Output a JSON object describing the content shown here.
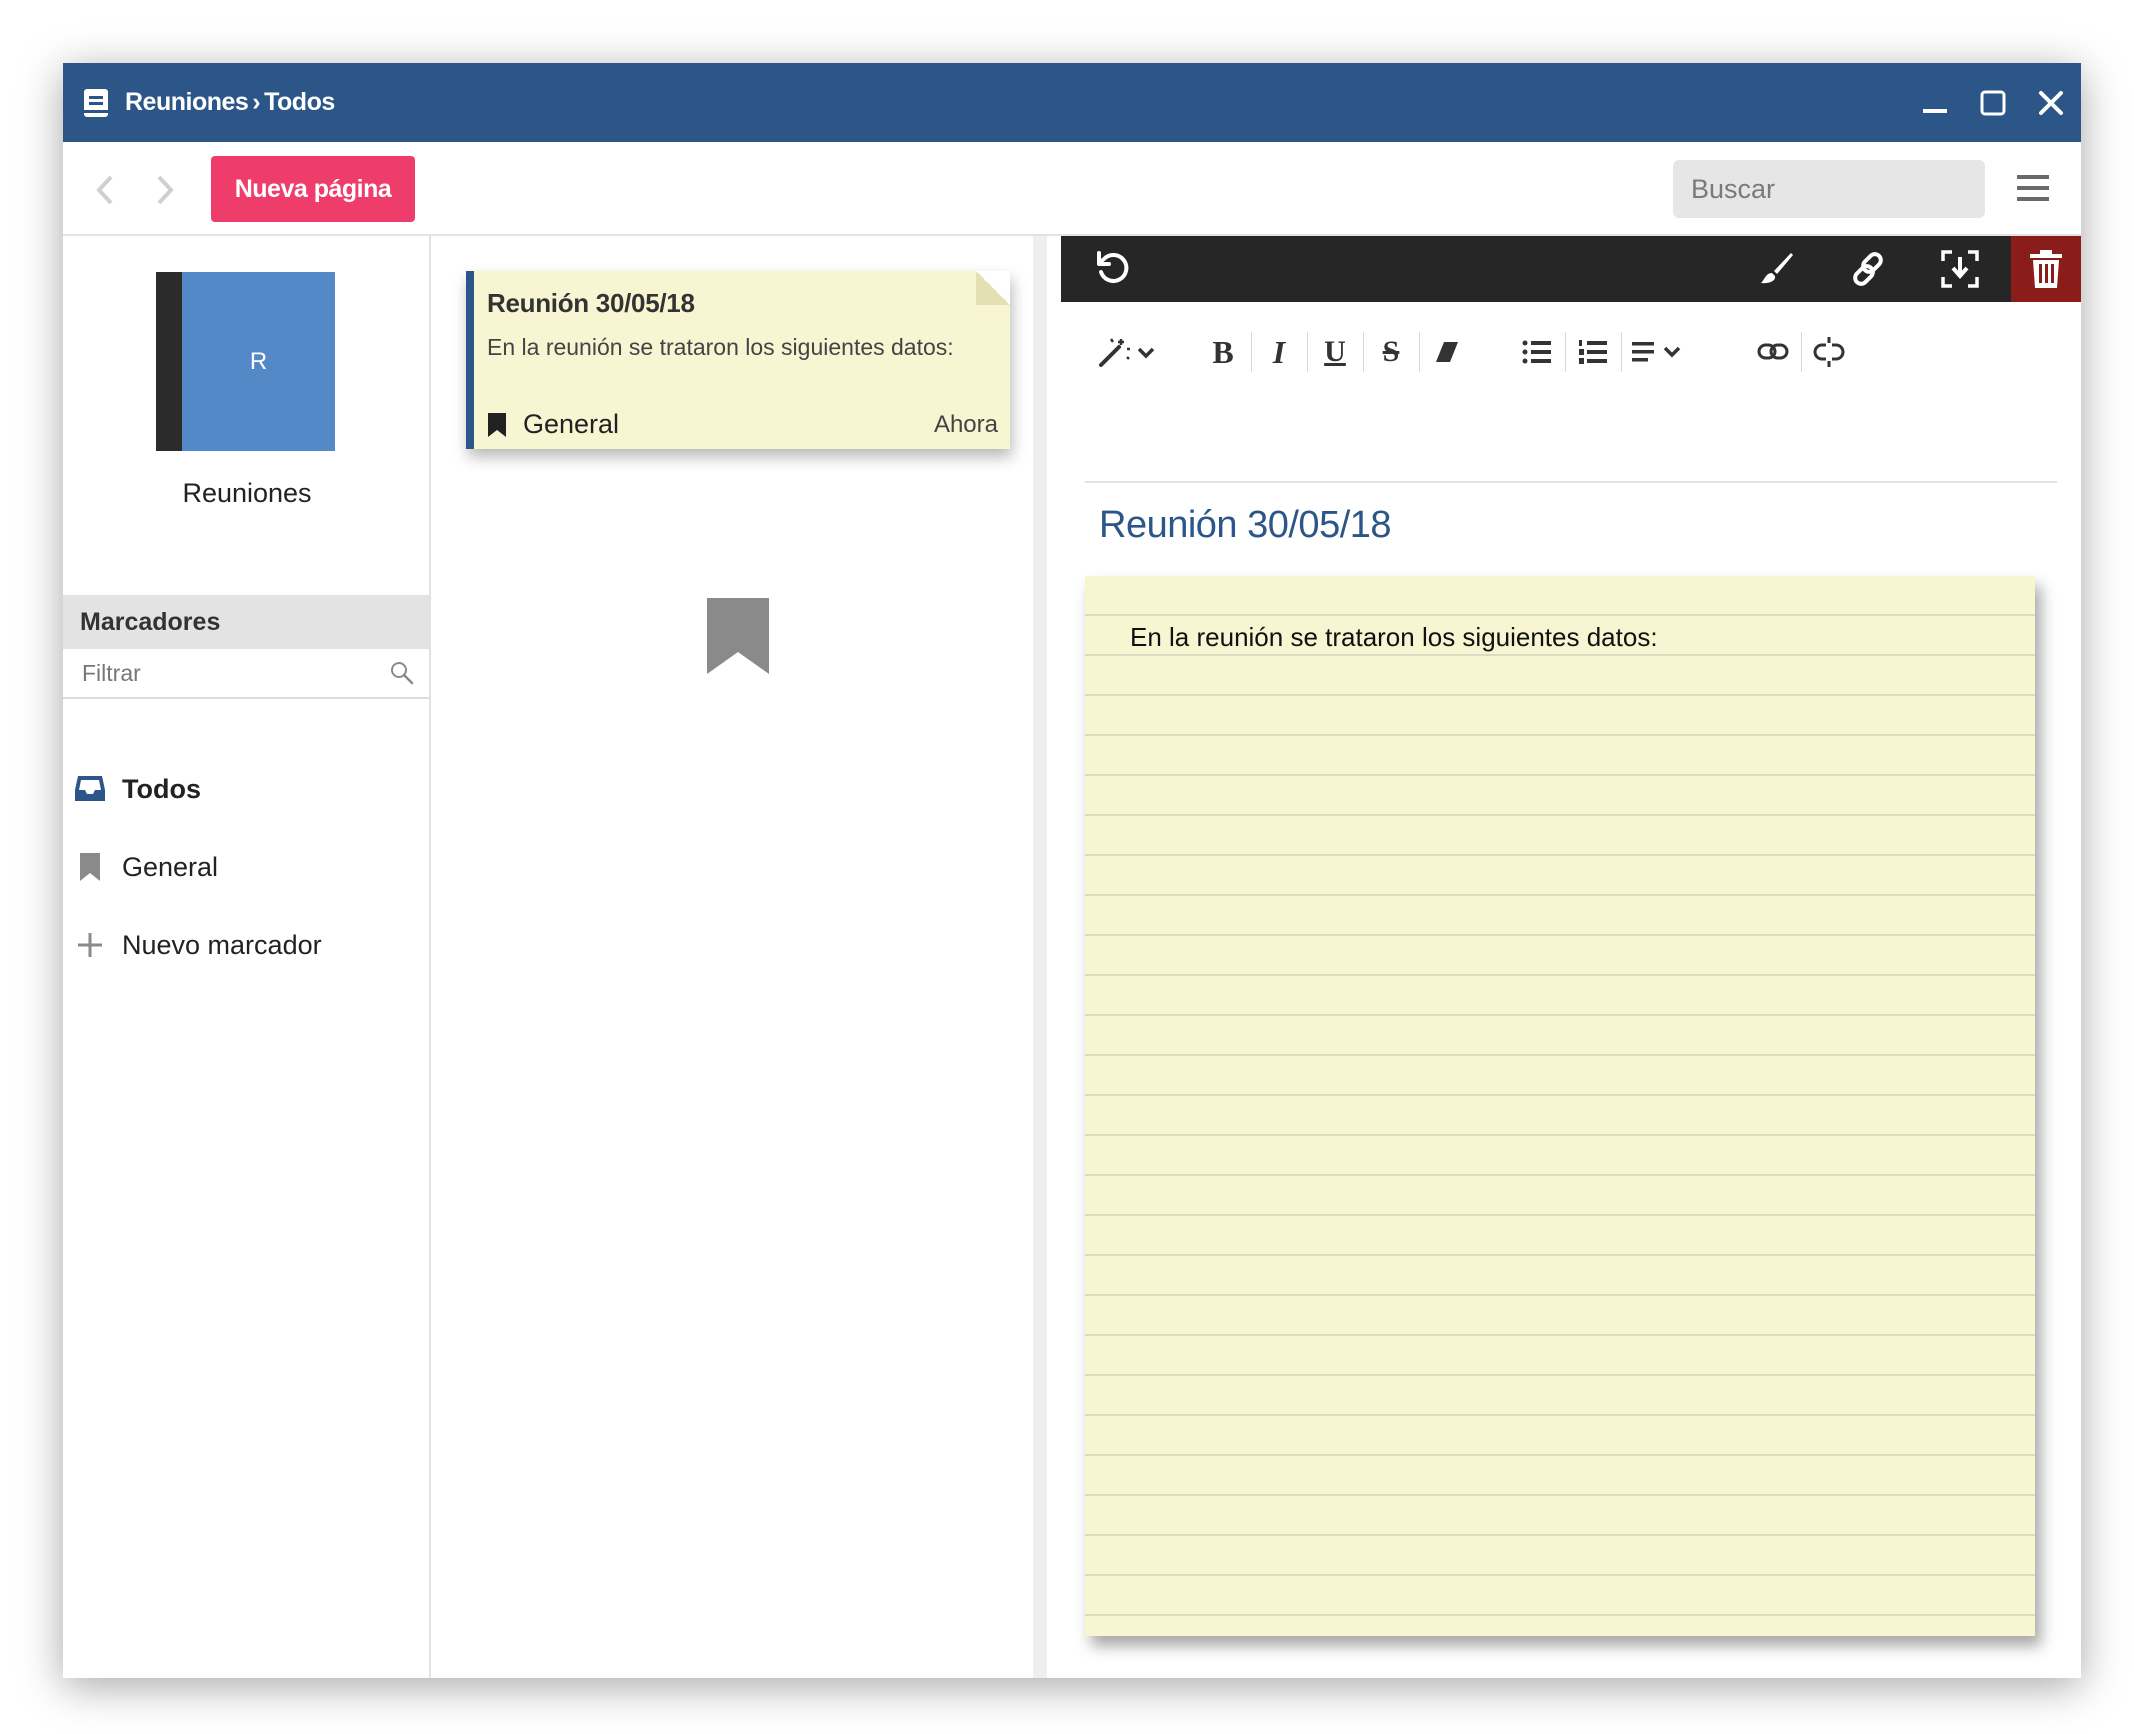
{
  "window": {
    "breadcrumb_root": "Reuniones",
    "breadcrumb_sep": "›",
    "breadcrumb_current": "Todos"
  },
  "toolbar": {
    "new_page_label": "Nueva página",
    "search_placeholder": "Buscar"
  },
  "sidebar": {
    "notebook_initial": "R",
    "notebook_name": "Reuniones",
    "bookmarks_header": "Marcadores",
    "filter_placeholder": "Filtrar",
    "items": [
      {
        "label": "Todos",
        "icon": "inbox-icon"
      },
      {
        "label": "General",
        "icon": "bookmark-icon"
      },
      {
        "label": "Nuevo marcador",
        "icon": "plus-icon"
      }
    ]
  },
  "note_list": {
    "notes": [
      {
        "title": "Reunión 30/05/18",
        "snippet": "En la reunión se trataron los siguientes datos:",
        "bookmark": "General",
        "time": "Ahora"
      }
    ]
  },
  "editor": {
    "title": "Reunión 30/05/18",
    "body": "En la reunión se trataron los siguientes datos:"
  },
  "colors": {
    "titlebar": "#2b5687",
    "accent_button": "#ee3d6a",
    "note_paper": "#f7f5d2",
    "trash": "#8a1c1a",
    "notebook_cover": "#5389c6"
  }
}
